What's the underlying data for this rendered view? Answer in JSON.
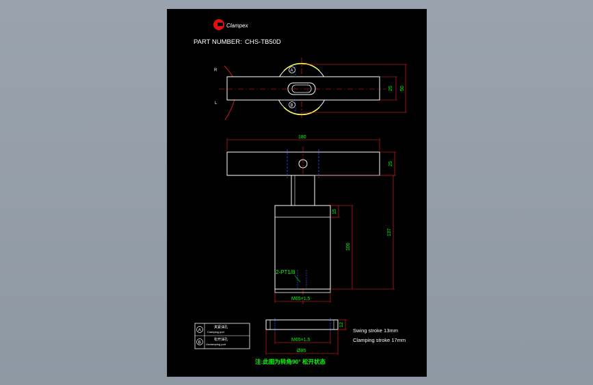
{
  "logo": {
    "brand": "Clampex",
    "mark": "G"
  },
  "header": {
    "label": "PART NUMBER:",
    "value": "CHS-TB50D"
  },
  "top_view": {
    "marker_R": "R",
    "marker_L": "L",
    "callout_A": "A",
    "callout_B": "B",
    "dim_25": "25",
    "dim_50": "50"
  },
  "front_view": {
    "dim_180": "180",
    "dim_25": "25",
    "dim_137": "137",
    "dim_15": "15",
    "dim_100": "100",
    "port_note": "2-PT1/8",
    "thread_body": "M65×1.5"
  },
  "nut_view": {
    "dim_12": "12",
    "thread": "M65×1.5",
    "dia": "Ø85"
  },
  "legend": {
    "rows": [
      {
        "symbol": "A",
        "cn": "夹紧油孔",
        "en": "Clamping port"
      },
      {
        "symbol": "B",
        "cn": "松开油孔",
        "en": "Unclamping port"
      }
    ]
  },
  "specs": {
    "swing": "Swing stroke 13mm",
    "clamping": "Clamping stroke 17mm"
  },
  "note": "注:此图为转角90° 松开状态",
  "colors": {
    "outline": "#ffffff",
    "dimension": "#ff2020",
    "dimension_text": "#00ff00",
    "hidden": "#3050ff",
    "accent": "#ffff00",
    "brand_red": "#e01010"
  }
}
